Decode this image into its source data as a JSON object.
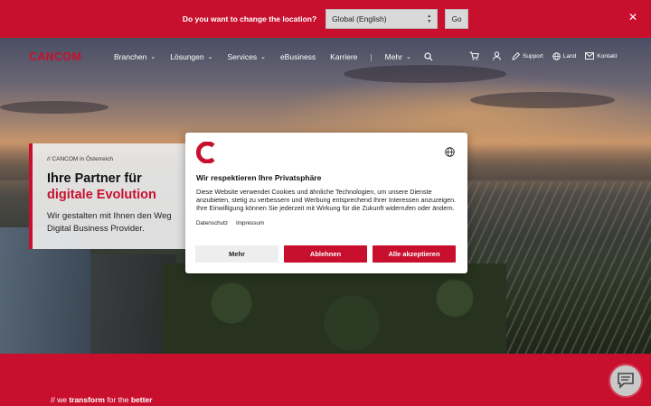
{
  "location_bar": {
    "question": "Do you want to change the location?",
    "selected_location": "Global (English)",
    "go_label": "Go",
    "close_icon": "close-icon"
  },
  "nav": {
    "logo": "CANCOM",
    "items": [
      {
        "label": "Branchen",
        "has_dropdown": true
      },
      {
        "label": "Lösungen",
        "has_dropdown": true
      },
      {
        "label": "Services",
        "has_dropdown": true
      },
      {
        "label": "eBusiness",
        "has_dropdown": false
      },
      {
        "label": "Karriere",
        "has_dropdown": false
      },
      {
        "label": "Mehr",
        "has_dropdown": true
      }
    ],
    "separator": "|",
    "right": {
      "support": "Support",
      "land": "Land",
      "kontakt": "Kontakt"
    }
  },
  "hero": {
    "kicker": "// CANCOM in Österreich",
    "headline_line1": "Ihre Partner für",
    "headline_line2": "digitale Evolution",
    "subtext_line1": "Wir gestalten mit Ihnen den Weg",
    "subtext_line2": "Digital Business Provider."
  },
  "consent": {
    "title": "Wir respektieren Ihre Privatsphäre",
    "text": "Diese Website verwendet Cookies und ähnliche Technologien, um unsere Dienste anzubieten, stetig zu verbessern und Werbung entsprechend Ihrer Interessen anzuzeigen. Ihre Einwilligung können Sie jederzeit mit Wirkung für die Zukunft widerrufen oder ändern.",
    "links": {
      "privacy": "Datenschutz",
      "imprint": "Impressum"
    },
    "buttons": {
      "more": "Mehr",
      "decline": "Ablehnen",
      "accept_all": "Alle akzeptieren"
    }
  },
  "footer_band": {
    "prefix": "// we ",
    "word1": "transform",
    "middle": " for the ",
    "word2": "better"
  },
  "colors": {
    "brand": "#c8102e"
  }
}
